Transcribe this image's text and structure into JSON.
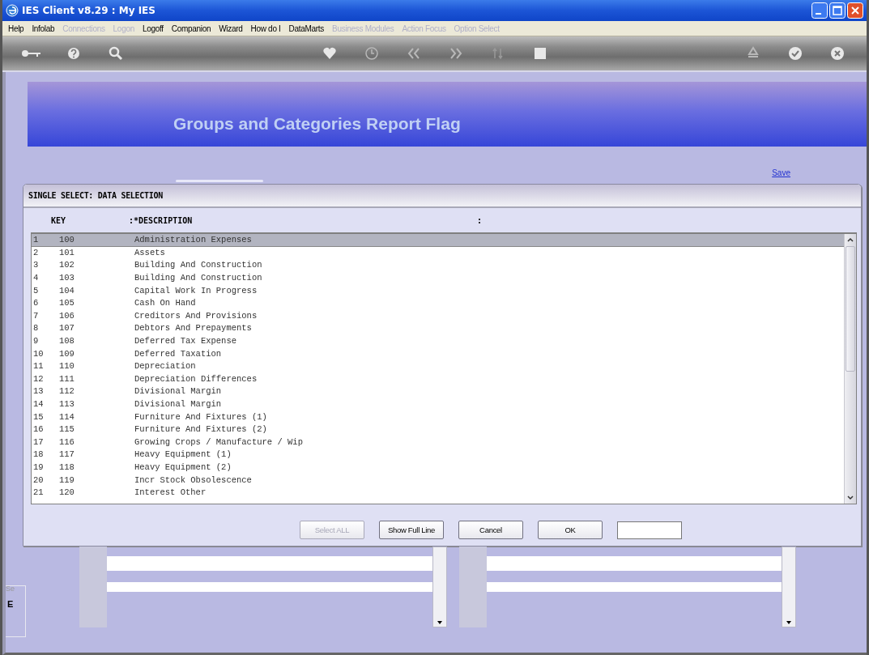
{
  "window": {
    "title": "IES Client v8.29 : My IES"
  },
  "menu": [
    {
      "label": "Help",
      "disabled": false
    },
    {
      "label": "Infolab",
      "disabled": false
    },
    {
      "label": "Connections",
      "disabled": true
    },
    {
      "label": "Logon",
      "disabled": true
    },
    {
      "label": "Logoff",
      "disabled": false
    },
    {
      "label": "Companion",
      "disabled": false
    },
    {
      "label": "Wizard",
      "disabled": false
    },
    {
      "label": "How do I",
      "disabled": false
    },
    {
      "label": "DataMarts",
      "disabled": false
    },
    {
      "label": "Business Modules",
      "disabled": true
    },
    {
      "label": "Action Focus",
      "disabled": true
    },
    {
      "label": "Option Select",
      "disabled": true
    }
  ],
  "banner": {
    "title": "Groups and Categories Report Flag"
  },
  "save_link": "Save",
  "dialog": {
    "title": "SINGLE SELECT: DATA SELECTION",
    "columns": [
      "KEY",
      ":*DESCRIPTION",
      ":"
    ],
    "rows": [
      {
        "index": "1",
        "key": "100",
        "description": "Administration Expenses",
        "selected": true
      },
      {
        "index": "2",
        "key": "101",
        "description": "Assets",
        "selected": false
      },
      {
        "index": "3",
        "key": "102",
        "description": "Building And Construction",
        "selected": false
      },
      {
        "index": "4",
        "key": "103",
        "description": "Building And Construction",
        "selected": false
      },
      {
        "index": "5",
        "key": "104",
        "description": "Capital Work In Progress",
        "selected": false
      },
      {
        "index": "6",
        "key": "105",
        "description": "Cash On Hand",
        "selected": false
      },
      {
        "index": "7",
        "key": "106",
        "description": "Creditors And Provisions",
        "selected": false
      },
      {
        "index": "8",
        "key": "107",
        "description": "Debtors And Prepayments",
        "selected": false
      },
      {
        "index": "9",
        "key": "108",
        "description": "Deferred Tax Expense",
        "selected": false
      },
      {
        "index": "10",
        "key": "109",
        "description": "Deferred Taxation",
        "selected": false
      },
      {
        "index": "11",
        "key": "110",
        "description": "Depreciation",
        "selected": false
      },
      {
        "index": "12",
        "key": "111",
        "description": "Depreciation Differences",
        "selected": false
      },
      {
        "index": "13",
        "key": "112",
        "description": "Divisional Margin",
        "selected": false
      },
      {
        "index": "14",
        "key": "113",
        "description": "Divisional Margin",
        "selected": false
      },
      {
        "index": "15",
        "key": "114",
        "description": "Furniture And Fixtures (1)",
        "selected": false
      },
      {
        "index": "16",
        "key": "115",
        "description": "Furniture And Fixtures (2)",
        "selected": false
      },
      {
        "index": "17",
        "key": "116",
        "description": "Growing Crops / Manufacture / Wip",
        "selected": false
      },
      {
        "index": "18",
        "key": "117",
        "description": "Heavy Equipment (1)",
        "selected": false
      },
      {
        "index": "19",
        "key": "118",
        "description": "Heavy Equipment (2)",
        "selected": false
      },
      {
        "index": "20",
        "key": "119",
        "description": "Incr Stock Obsolescence",
        "selected": false
      },
      {
        "index": "21",
        "key": "120",
        "description": "Interest Other",
        "selected": false
      }
    ],
    "buttons": [
      {
        "label": "Select ALL",
        "disabled": true
      },
      {
        "label": "Show Full Line",
        "disabled": false
      },
      {
        "label": "Cancel",
        "disabled": false
      },
      {
        "label": "OK",
        "disabled": false
      }
    ]
  },
  "side_labels": [
    "Se",
    "E"
  ]
}
